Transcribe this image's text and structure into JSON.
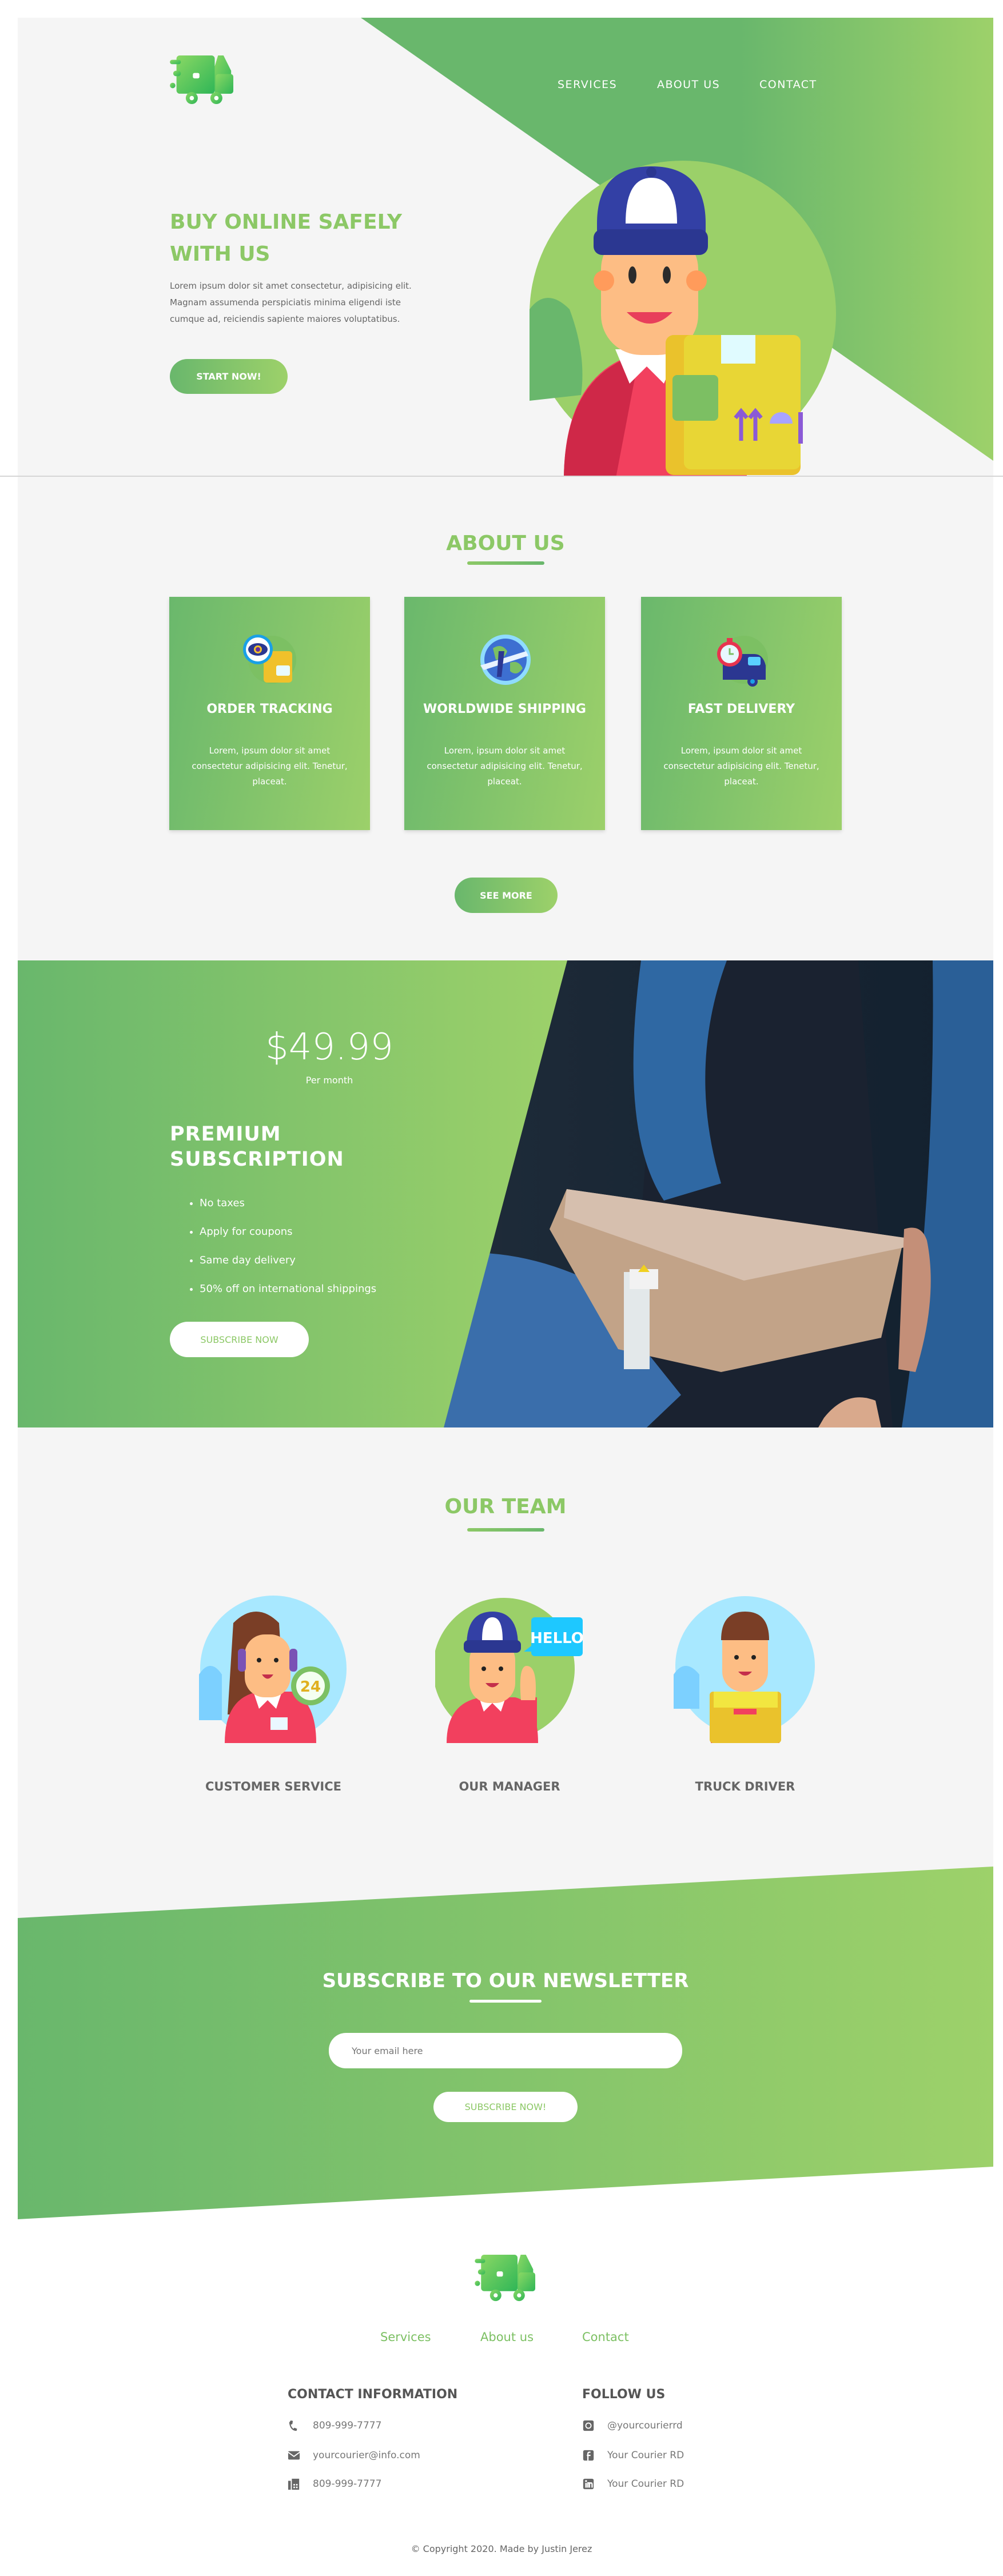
{
  "colors": {
    "brand_green": "#8cc866",
    "gradient_start": "#69b76c",
    "gradient_end": "#9dd16a",
    "text_gray": "#666666"
  },
  "nav": {
    "items": [
      "SERVICES",
      "ABOUT US",
      "CONTACT"
    ]
  },
  "hero": {
    "title": "BUY ONLINE SAFELY WITH US",
    "text": "Lorem ipsum dolor sit amet consectetur, adipisicing elit. Magnam assumenda perspiciatis minima eligendi iste cumque ad, reiciendis sapiente maiores voluptatibus.",
    "cta": "START NOW!",
    "illustration": "delivery-man-with-box"
  },
  "about": {
    "title": "ABOUT US",
    "cards": [
      {
        "icon": "order-tracking-icon",
        "title": "ORDER TRACKING",
        "text": "Lorem, ipsum dolor sit amet consectetur adipisicing elit. Tenetur, placeat."
      },
      {
        "icon": "worldwide-shipping-icon",
        "title": "WORLDWIDE SHIPPING",
        "text": "Lorem, ipsum dolor sit amet consectetur adipisicing elit. Tenetur, placeat."
      },
      {
        "icon": "fast-delivery-icon",
        "title": "FAST DELIVERY",
        "text": "Lorem, ipsum dolor sit amet consectetur adipisicing elit. Tenetur, placeat."
      }
    ],
    "see_more": "SEE MORE"
  },
  "premium": {
    "price": "$49.99",
    "period": "Per month",
    "title": "PREMIUM SUBSCRIPTION",
    "features": [
      "No taxes",
      "Apply for coupons",
      "Same day delivery",
      "50% off on international shippings"
    ],
    "cta": "SUBSCRIBE NOW",
    "photo": "hands-passing-cardboard-box"
  },
  "team": {
    "title": "OUR TEAM",
    "members": [
      {
        "role": "CUSTOMER SERVICE"
      },
      {
        "role": "OUR MANAGER",
        "bubble": "HELLO"
      },
      {
        "role": "TRUCK DRIVER"
      }
    ],
    "badge_24": "24"
  },
  "newsletter": {
    "title": "SUBSCRIBE TO OUR NEWSLETTER",
    "placeholder": "Your email here",
    "cta": "SUBSCRIBE NOW!"
  },
  "footer": {
    "links": [
      "Services",
      "About us",
      "Contact"
    ],
    "contact_title": "CONTACT INFORMATION",
    "contact": [
      {
        "icon": "phone-icon",
        "text": "809-999-7777"
      },
      {
        "icon": "envelope-icon",
        "text": "yourcourier@info.com"
      },
      {
        "icon": "fax-icon",
        "text": "809-999-7777"
      }
    ],
    "follow_title": "FOLLOW US",
    "social": [
      {
        "icon": "instagram-icon",
        "text": "@yourcourierrd"
      },
      {
        "icon": "facebook-icon",
        "text": "Your Courier RD"
      },
      {
        "icon": "linkedin-icon",
        "text": "Your Courier RD"
      }
    ],
    "copyright": "© Copyright 2020. Made by Justin Jerez"
  }
}
